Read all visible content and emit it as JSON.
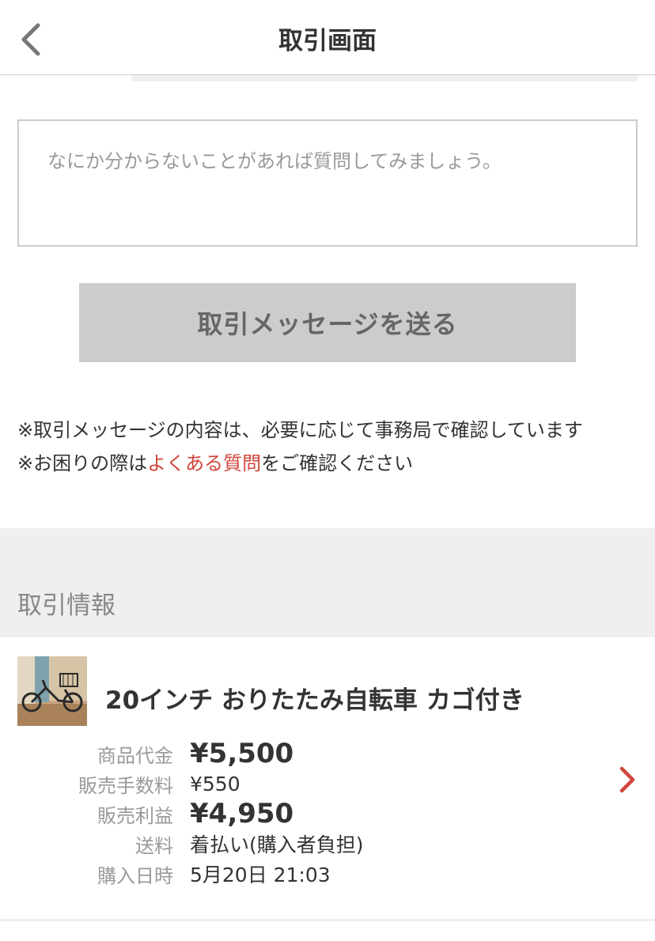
{
  "navbar": {
    "title": "取引画面",
    "back_icon": "chevron-left-icon"
  },
  "message": {
    "placeholder": "なにか分からないことがあれば質問してみましょう。",
    "send_label": "取引メッセージを送る"
  },
  "notes": {
    "line1": "※取引メッセージの内容は、必要に応じて事務局で確認しています",
    "line2_prefix": "※お困りの際は",
    "line2_link": "よくある質問",
    "line2_suffix": "をご確認ください"
  },
  "section": {
    "title": "取引情報"
  },
  "item": {
    "title": "20インチ おりたたみ自転車 カゴ付き",
    "thumbnail": "bicycle-photo",
    "details": [
      {
        "label": "商品代金",
        "value": "¥5,500"
      },
      {
        "label": "販売手数料",
        "value": "¥550"
      },
      {
        "label": "販売利益",
        "value": "¥4,950"
      },
      {
        "label": "送料",
        "value": "着払い(購入者負担)"
      },
      {
        "label": "購入日時",
        "value": "5月20日 21:03"
      }
    ],
    "chevron_icon": "chevron-right-icon"
  },
  "colors": {
    "accent": "#d0463c",
    "button_bg": "#cccccc",
    "section_bg": "#efefef"
  }
}
